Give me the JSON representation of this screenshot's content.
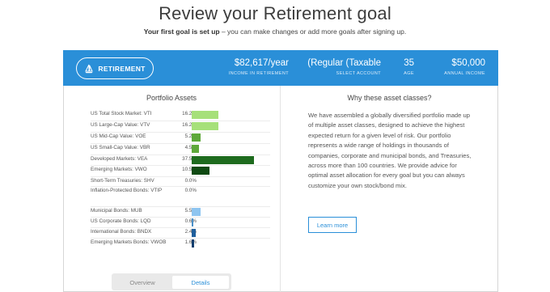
{
  "header": {
    "title": "Review your Retirement goal",
    "subtitle_bold": "Your first goal is set up",
    "subtitle_rest": " – you can make changes or add more goals after signing up."
  },
  "goal_bar": {
    "goal_label": "RETIREMENT",
    "income_value": "$82,617/year",
    "income_label": "INCOME IN RETIREMENT",
    "account_value": "(Regular (Taxable",
    "account_label": "SELECT ACCOUNT",
    "age_value": "35",
    "age_label": "AGE",
    "annual_income_value": "$50,000",
    "annual_income_label": "ANNUAL INCOME",
    "bar_color": "#2a8fd8"
  },
  "portfolio": {
    "title": "Portfolio Assets",
    "assets": [
      {
        "label": "US Total Stock Market: VTI",
        "pct": "16.2%",
        "value": 16.2,
        "color": "#a6e07a"
      },
      {
        "label": "US Large-Cap Value: VTV",
        "pct": "16.2%",
        "value": 16.2,
        "color": "#a6e07a"
      },
      {
        "label": "US Mid-Cap Value: VOE",
        "pct": "5.2%",
        "value": 5.2,
        "color": "#5ea83a"
      },
      {
        "label": "US Small-Cap Value: VBR",
        "pct": "4.5%",
        "value": 4.5,
        "color": "#5ea83a"
      },
      {
        "label": "Developed Markets: VEA",
        "pct": "37.5%",
        "value": 37.5,
        "color": "#1e6b1e"
      },
      {
        "label": "Emerging Markets: VWO",
        "pct": "10.5%",
        "value": 10.5,
        "color": "#0f4a12"
      },
      {
        "label": "Short-Term Treasuries: SHV",
        "pct": "0.0%",
        "value": 0.0,
        "color": "#9ccbf0"
      },
      {
        "label": "Inflation-Protected Bonds: VTIP",
        "pct": "0.0%",
        "value": 0.0,
        "color": "#9ccbf0"
      },
      {
        "label": "Municipal Bonds: MUB",
        "pct": "5.5%",
        "value": 5.5,
        "color": "#8ec5f0"
      },
      {
        "label": "US Corporate Bonds: LQD",
        "pct": "0.6%",
        "value": 0.6,
        "color": "#4a90c8"
      },
      {
        "label": "International Bonds: BNDX",
        "pct": "2.4%",
        "value": 2.4,
        "color": "#1f5f9c"
      },
      {
        "label": "Emerging Markets Bonds: VWOB",
        "pct": "1.6%",
        "value": 1.6,
        "color": "#123e6e"
      }
    ]
  },
  "why": {
    "title": "Why these asset classes?",
    "text": "We have assembled a globally diversified portfolio made up of multiple asset classes, designed to achieve the highest expected return for a given level of risk. Our portfolio represents a wide range of holdings in thousands of companies, corporate and municipal bonds, and Treasuries, across more than 100 countries. We provide advice for optimal asset allocation for every goal but you can always customize your own stock/bond mix.",
    "learn_more": "Learn more"
  },
  "toggle": {
    "overview": "Overview",
    "details": "Details"
  }
}
